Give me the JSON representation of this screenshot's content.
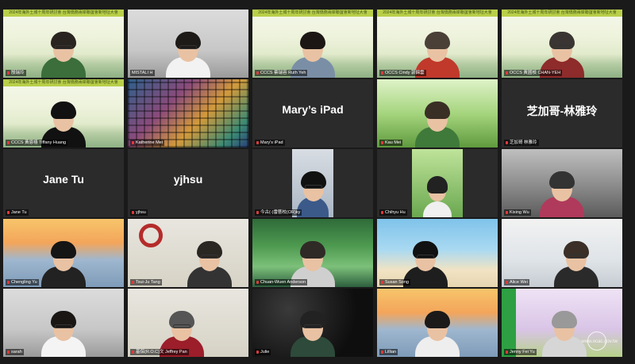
{
  "meeting": {
    "banner_text": "2024年海外土城十周年研討會 台灣僑務兩岸聯誼會新地址大會",
    "watermark": "www.ocac.gov.tw",
    "colors": {
      "active_border": "#e6d23a",
      "banner": "#b9cf49",
      "mic_muted": "#e23a3a"
    },
    "participants": [
      {
        "name": "殷瑞玲",
        "big_name": ""
      },
      {
        "name": "MISTALI H",
        "big_name": ""
      },
      {
        "name": "CCCS 蔡瑞容 Ruth Yeh",
        "big_name": ""
      },
      {
        "name": "OCCS Cindy 郭錦雲",
        "big_name": ""
      },
      {
        "name": "OCCS 黃國楨 CHAN-YEH",
        "big_name": ""
      },
      {
        "name": "CCCS 黃恩禧 Tiffany Huang",
        "big_name": ""
      },
      {
        "name": "Katherine Mei",
        "big_name": ""
      },
      {
        "name": "Mary's iPad",
        "big_name": "Mary’s iPad"
      },
      {
        "name": "Kau Mei",
        "big_name": ""
      },
      {
        "name": "芝加哥 林雅玲",
        "big_name": "芝加哥-林雅玲"
      },
      {
        "name": "Jane Tu",
        "big_name": "Jane Tu"
      },
      {
        "name": "yjhsu",
        "big_name": "yjhsu"
      },
      {
        "name": "今古(-)雷藝校(OR)ky",
        "big_name": ""
      },
      {
        "name": "Chihyu Hu",
        "big_name": ""
      },
      {
        "name": "Kixing Wu",
        "big_name": ""
      },
      {
        "name": "Chengling Yu",
        "big_name": ""
      },
      {
        "name": "Tsui-Ju Tang",
        "big_name": ""
      },
      {
        "name": "Chuan-Wuen Anderson",
        "big_name": ""
      },
      {
        "name": "Susan Song",
        "big_name": ""
      },
      {
        "name": "Alice Wei",
        "big_name": ""
      },
      {
        "name": "sarah",
        "big_name": ""
      },
      {
        "name": "基保(R.O.C)文 Jeffrey Pan",
        "big_name": ""
      },
      {
        "name": "Julie",
        "big_name": ""
      },
      {
        "name": "Lillian",
        "big_name": ""
      },
      {
        "name": "Jenny Fei Yu",
        "big_name": ""
      }
    ]
  }
}
